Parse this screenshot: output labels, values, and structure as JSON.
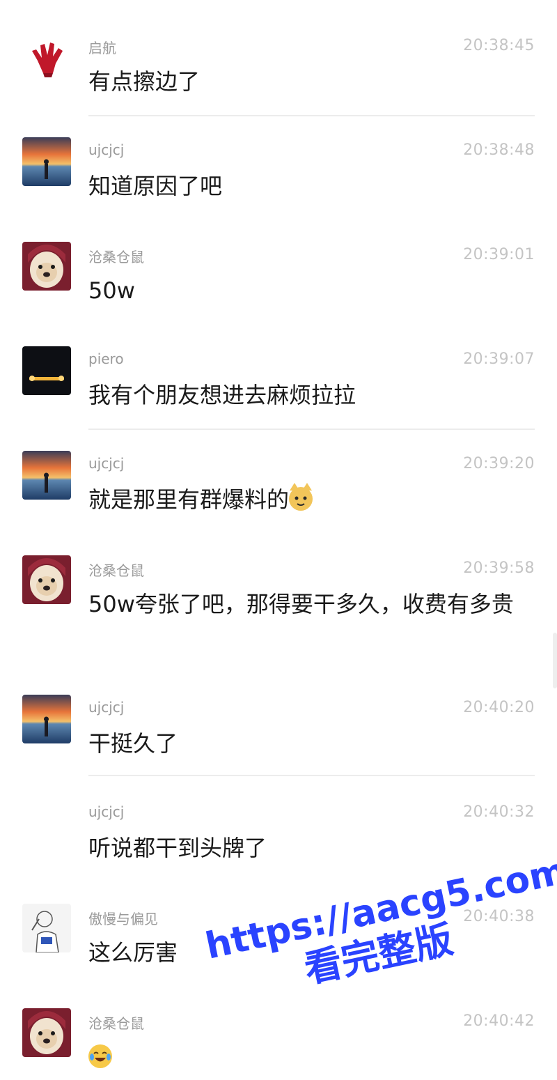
{
  "messages": [
    {
      "sender": "启航",
      "time": "20:38:45",
      "text": "有点擦边了",
      "avatar": "red-hand-avatar"
    },
    {
      "sender": "ujcjcj",
      "time": "20:38:48",
      "text": "知道原因了吧",
      "avatar": "sunset-lake-avatar"
    },
    {
      "sender": "沧桑仓鼠",
      "time": "20:39:01",
      "text": "50w",
      "avatar": "dog-hood-avatar"
    },
    {
      "sender": "piero",
      "time": "20:39:07",
      "text": "我有个朋友想进去麻烦拉拉",
      "avatar": "night-car-avatar"
    },
    {
      "sender": "ujcjcj",
      "time": "20:39:20",
      "text": "就是那里有群爆料的",
      "emoji": "cat-face-emoji",
      "avatar": "sunset-lake-avatar"
    },
    {
      "sender": "沧桑仓鼠",
      "time": "20:39:58",
      "text": "50w夸张了吧，那得要干多久，收费有多贵",
      "avatar": "dog-hood-avatar"
    },
    {
      "sender": "ujcjcj",
      "time": "20:40:20",
      "text": "干挺久了",
      "avatar": "sunset-lake-avatar"
    },
    {
      "sender": "ujcjcj",
      "time": "20:40:32",
      "text": "听说都干到头牌了",
      "avatar": ""
    },
    {
      "sender": "傲慢与偏见",
      "time": "20:40:38",
      "text": "这么厉害",
      "avatar": "sketch-man-avatar"
    },
    {
      "sender": "沧桑仓鼠",
      "time": "20:40:42",
      "text": "",
      "emoji": "crying-laughing-emoji",
      "avatar": "dog-hood-avatar"
    }
  ],
  "watermark": {
    "url": "https://aacg5.com",
    "subtitle": "看完整版",
    "color": "#2a43ff"
  },
  "colors": {
    "sender": "#9a9a9a",
    "time": "#c4c4c4",
    "text": "#1a1a1a",
    "divider": "#ececec"
  }
}
